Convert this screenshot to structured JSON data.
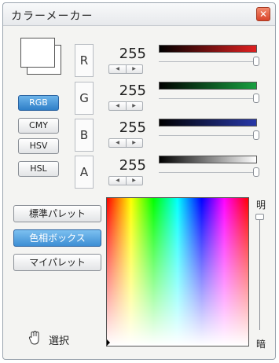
{
  "window": {
    "title": "カラーメーカー"
  },
  "modes": [
    {
      "label": "RGB",
      "active": true
    },
    {
      "label": "CMY",
      "active": false
    },
    {
      "label": "HSV",
      "active": false
    },
    {
      "label": "HSL",
      "active": false
    }
  ],
  "channels": [
    {
      "letter": "R",
      "value": "255",
      "gradient_to": "#e02020"
    },
    {
      "letter": "G",
      "value": "255",
      "gradient_to": "#18a040"
    },
    {
      "letter": "B",
      "value": "255",
      "gradient_to": "#2838a8"
    },
    {
      "letter": "A",
      "value": "255",
      "gradient_to": "#ffffff"
    }
  ],
  "palettes": [
    {
      "label": "標準パレット",
      "active": false
    },
    {
      "label": "色相ボックス",
      "active": true
    },
    {
      "label": "マイパレット",
      "active": false
    }
  ],
  "brightness": {
    "top_label": "明",
    "bottom_label": "暗"
  },
  "tool": {
    "label": "選択",
    "icon": "hand-icon"
  },
  "colors": {
    "current": "#ffffff",
    "accent": "#2f7fc8"
  }
}
